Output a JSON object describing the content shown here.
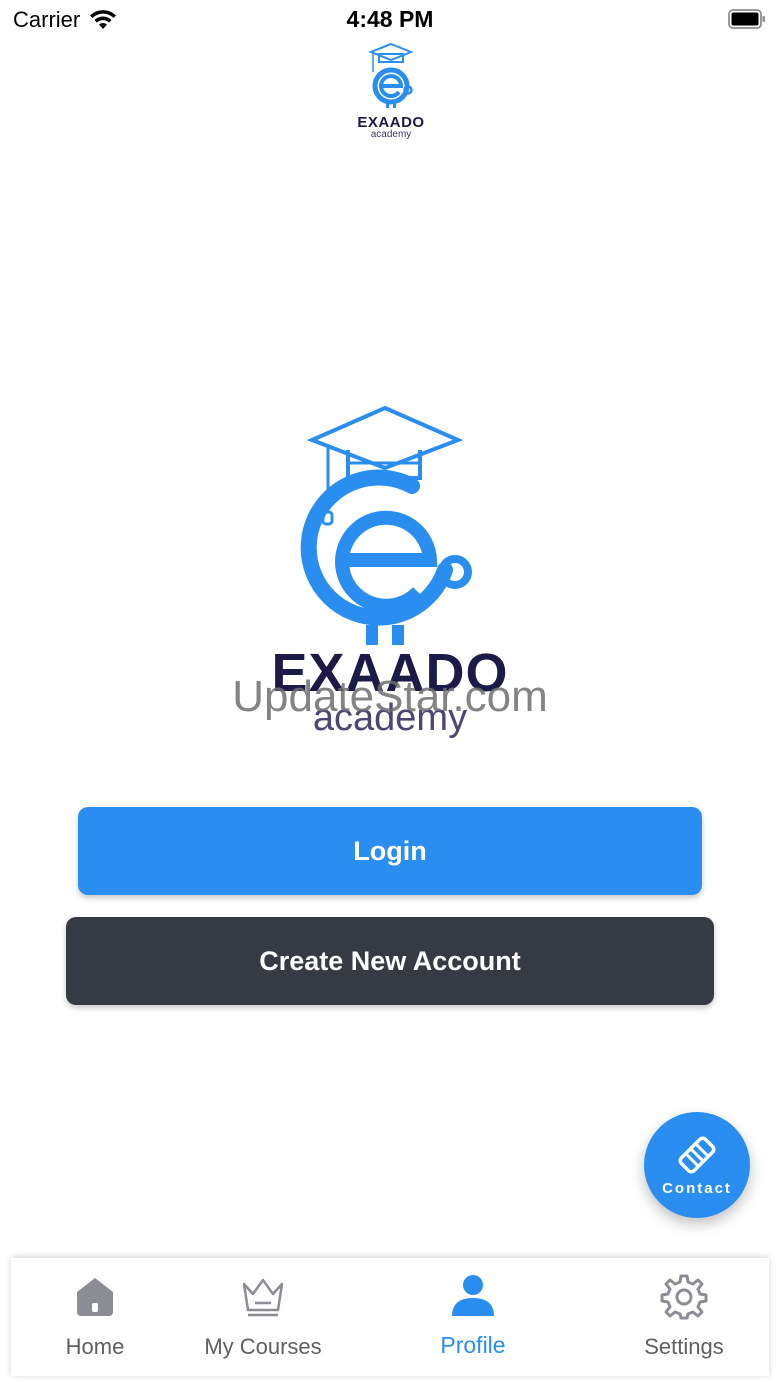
{
  "status_bar": {
    "carrier": "Carrier",
    "time": "4:48 PM",
    "wifi_icon": "wifi-icon",
    "battery_icon": "battery-icon"
  },
  "header": {
    "logo_brand": "EXAADO",
    "logo_sub": "academy"
  },
  "main_logo": {
    "brand": "EXAADO",
    "sub": "academy",
    "icon": "graduation-cap-e-logo"
  },
  "watermark": "UpdateStar.com",
  "actions": {
    "login_label": "Login",
    "create_account_label": "Create New Account"
  },
  "contact_fab": {
    "label": "Contact",
    "icon": "handshake-icon"
  },
  "tab_bar": {
    "active": "Profile",
    "items": [
      {
        "label": "Home",
        "icon": "home-icon"
      },
      {
        "label": "My Courses",
        "icon": "crown-icon"
      },
      {
        "label": "Profile",
        "icon": "user-icon"
      },
      {
        "label": "Settings",
        "icon": "gear-icon"
      }
    ]
  },
  "colors": {
    "accent": "#2a8ef0",
    "dark_button": "#363a43",
    "brand_navy": "#1c1b47",
    "inactive_tab": "#5f5f64"
  }
}
